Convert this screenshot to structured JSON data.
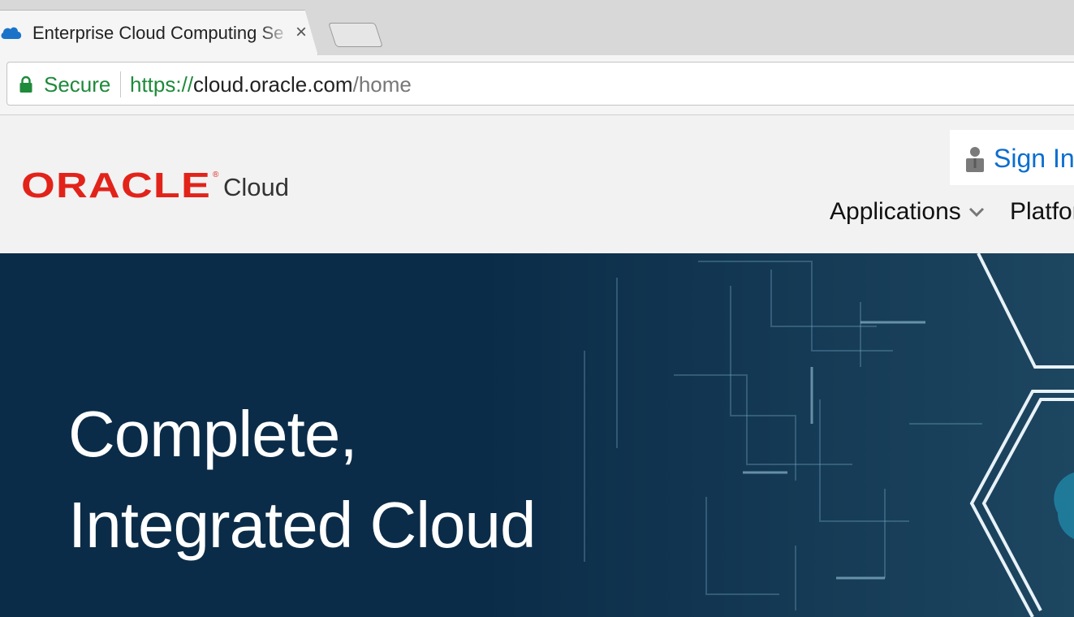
{
  "browser": {
    "tab": {
      "title": "Enterprise Cloud Computing Se",
      "close": "×",
      "favicon": "cloud-icon"
    },
    "omnibox": {
      "secure_label": "Secure",
      "url_scheme": "https://",
      "url_host": "cloud.oracle.com",
      "url_path": "/home"
    },
    "colors": {
      "secure": "#1e8a3a"
    }
  },
  "header": {
    "logo_text": "ORACLE",
    "logo_reg": "®",
    "logo_suffix": "Cloud",
    "signin_label": "Sign In",
    "nav": [
      {
        "label": "Applications"
      },
      {
        "label": "Platfor"
      }
    ],
    "colors": {
      "brand_red": "#e2231a",
      "link_blue": "#0a6ecf"
    }
  },
  "hero": {
    "headline_line1": "Complete,",
    "headline_line2": "Integrated Cloud",
    "colors": {
      "background": "#0b2c48"
    }
  }
}
